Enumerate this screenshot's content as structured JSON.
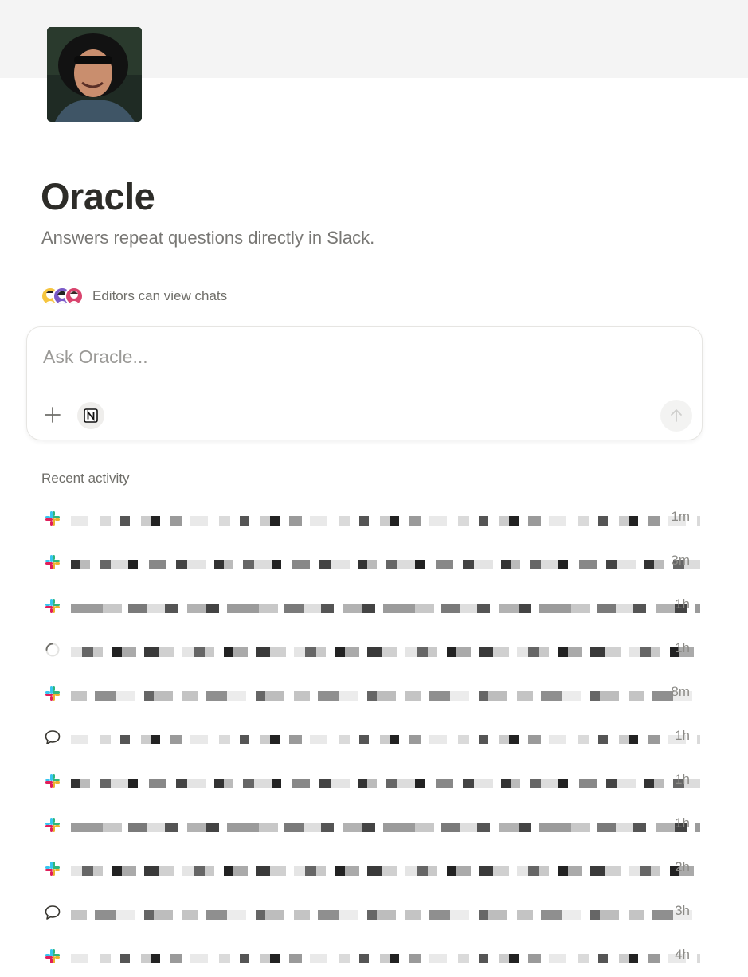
{
  "page": {
    "title": "Oracle",
    "description": "Answers repeat questions directly in Slack.",
    "editors_text": "Editors can view chats"
  },
  "ask": {
    "placeholder": "Ask Oracle..."
  },
  "recent": {
    "label": "Recent activity",
    "items": [
      {
        "source": "slack",
        "text": "[redacted]",
        "time": "1m"
      },
      {
        "source": "slack",
        "text": "[redacted]",
        "time": "3m"
      },
      {
        "source": "slack",
        "text": "[redacted]",
        "time": "1h"
      },
      {
        "source": "loading",
        "text": "[redacted]",
        "time": "1h"
      },
      {
        "source": "slack",
        "text": "[redacted]",
        "time": "8m"
      },
      {
        "source": "chat",
        "text": "[redacted]",
        "time": "1h"
      },
      {
        "source": "slack",
        "text": "[redacted]",
        "time": "1h"
      },
      {
        "source": "slack",
        "text": "[redacted]",
        "time": "1h"
      },
      {
        "source": "slack",
        "text": "[redacted]",
        "time": "2h"
      },
      {
        "source": "chat",
        "text": "[redacted]",
        "time": "3h"
      },
      {
        "source": "slack",
        "text": "[redacted]",
        "time": "4h"
      }
    ]
  },
  "colors": {
    "cover": "#f4f4f4",
    "slack_blue": "#36c5f0",
    "slack_green": "#2eb67d",
    "slack_yellow": "#ecb22e",
    "slack_red": "#e01e5a"
  },
  "icons": {
    "slack": "slack-icon",
    "chat": "chat-bubble-icon",
    "loading": "loading-spinner-icon",
    "plus": "plus-icon",
    "notion": "notion-icon",
    "send": "arrow-up-icon"
  }
}
